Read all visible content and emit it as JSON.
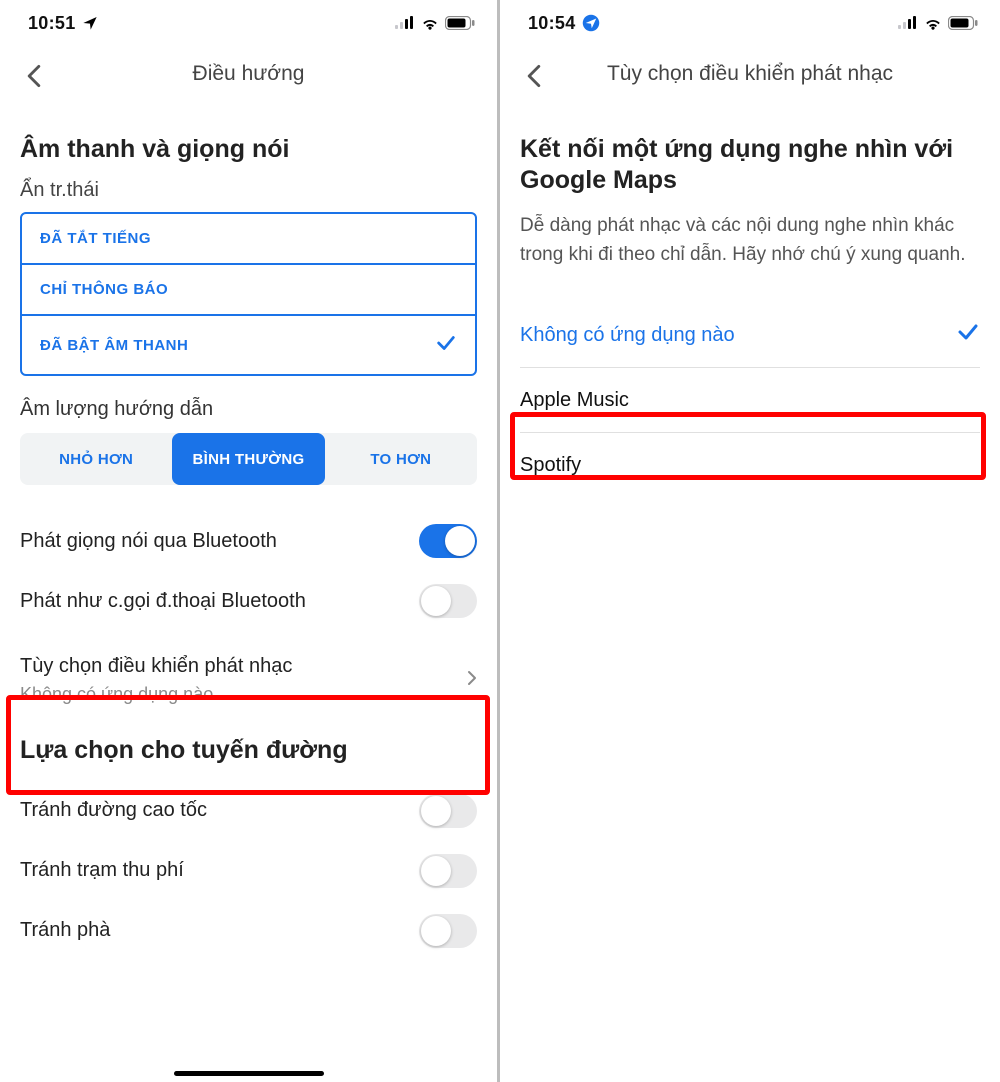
{
  "left": {
    "status": {
      "time": "10:51",
      "loc_icon": "location-filled"
    },
    "header": {
      "title": "Điều hướng"
    },
    "sound_voice": {
      "heading": "Âm thanh và giọng nói",
      "status_label": "Ẩn tr.thái",
      "options": {
        "muted": "ĐÃ TẮT TIẾNG",
        "alerts_only": "CHỈ THÔNG BÁO",
        "unmuted": "ĐÃ BẬT ÂM THANH"
      },
      "selected_index": 2
    },
    "volume": {
      "label": "Âm lượng hướng dẫn",
      "options": {
        "softer": "NHỎ HƠN",
        "normal": "BÌNH THƯỜNG",
        "louder": "TO HƠN"
      },
      "selected_index": 1
    },
    "toggles": {
      "bt_voice": {
        "label": "Phát giọng nói qua Bluetooth",
        "on": true
      },
      "bt_call": {
        "label": "Phát như c.gọi đ.thoại Bluetooth",
        "on": false
      }
    },
    "music": {
      "title": "Tùy chọn điều khiển phát nhạc",
      "subtitle": "Không có ứng dụng nào"
    },
    "route": {
      "heading": "Lựa chọn cho tuyến đường",
      "highways": {
        "label": "Tránh đường cao tốc",
        "on": false
      },
      "tolls": {
        "label": "Tránh trạm thu phí",
        "on": false
      },
      "ferries": {
        "label": "Tránh phà",
        "on": false
      }
    }
  },
  "right": {
    "status": {
      "time": "10:54",
      "loc_icon": "location-circle"
    },
    "header": {
      "title": "Tùy chọn điều khiển phát nhạc"
    },
    "heading": "Kết nối một ứng dụng nghe nhìn với Google Maps",
    "desc": "Dễ dàng phát nhạc và các nội dung nghe nhìn khác trong khi đi theo chỉ dẫn. Hãy nhớ chú ý xung quanh.",
    "options": {
      "none": "Không có ứng dụng nào",
      "apple": "Apple Music",
      "spotify": "Spotify"
    },
    "selected_index": 0
  }
}
